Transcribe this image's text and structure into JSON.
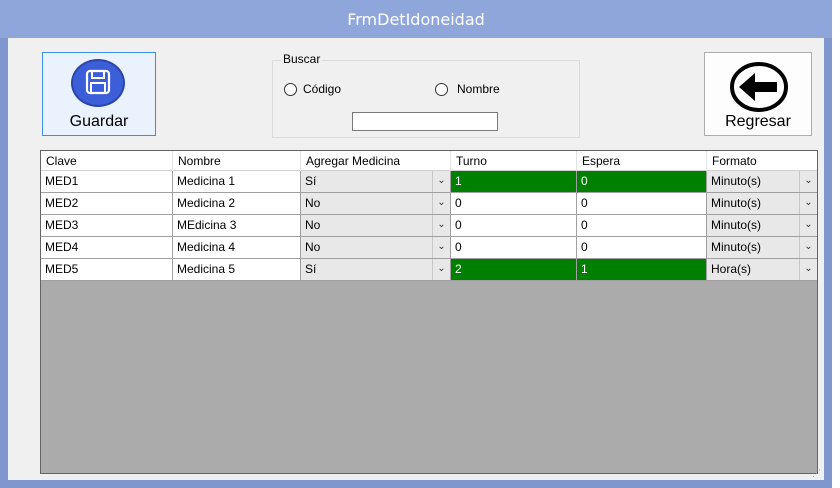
{
  "window": {
    "title": "FrmDetIdoneidad"
  },
  "toolbar": {
    "guardar_label": "Guardar",
    "regresar_label": "Regresar"
  },
  "buscar": {
    "legend": "Buscar",
    "option_codigo": "Código",
    "option_nombre": "Nombre",
    "search_value": ""
  },
  "grid": {
    "columns": [
      "Clave",
      "Nombre",
      "Agregar Medicina",
      "Turno",
      "Espera",
      "Formato"
    ],
    "rows": [
      {
        "clave": "MED1",
        "nombre": "Medicina 1",
        "agregar": "Sí",
        "turno": "1",
        "espera": "0",
        "formato": "Minuto(s)",
        "highlight": true
      },
      {
        "clave": "MED2",
        "nombre": "Medicina 2",
        "agregar": "No",
        "turno": "0",
        "espera": "0",
        "formato": "Minuto(s)",
        "highlight": false
      },
      {
        "clave": "MED3",
        "nombre": "MEdicina 3",
        "agregar": "No",
        "turno": "0",
        "espera": "0",
        "formato": "Minuto(s)",
        "highlight": false
      },
      {
        "clave": "MED4",
        "nombre": "Medicina 4",
        "agregar": "No",
        "turno": "0",
        "espera": "0",
        "formato": "Minuto(s)",
        "highlight": false
      },
      {
        "clave": "MED5",
        "nombre": "Medicina 5",
        "agregar": "Sí",
        "turno": "2",
        "espera": "1",
        "formato": "Hora(s)",
        "highlight": true
      }
    ]
  },
  "colors": {
    "highlight": "#008000",
    "titlebar": "#8fa6da",
    "save_icon": "#3c5fd9"
  },
  "icons": {
    "save": "floppy-disk-icon",
    "back": "arrow-left-icon",
    "dropdown": "chevron-down-icon"
  }
}
